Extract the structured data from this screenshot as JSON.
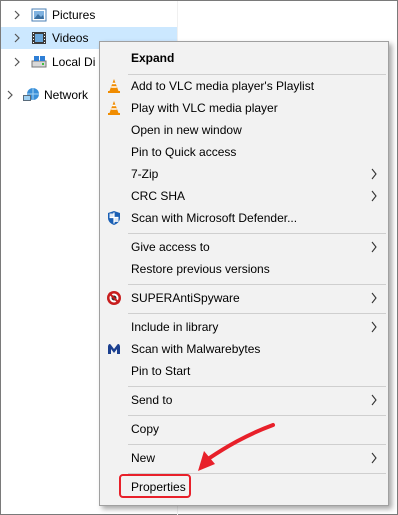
{
  "tree": {
    "items": [
      {
        "label": "Pictures"
      },
      {
        "label": "Videos"
      },
      {
        "label": "Local Di"
      },
      {
        "label": "Network"
      }
    ]
  },
  "menu": {
    "items": [
      {
        "label": "Expand",
        "icon": "none"
      },
      {
        "label": "Add to VLC media player's Playlist",
        "icon": "vlc-cone-icon"
      },
      {
        "label": "Play with VLC media player",
        "icon": "vlc-cone-icon"
      },
      {
        "label": "Open in new window",
        "icon": "none"
      },
      {
        "label": "Pin to Quick access",
        "icon": "none"
      },
      {
        "label": "7-Zip",
        "icon": "none",
        "submenu": true
      },
      {
        "label": "CRC SHA",
        "icon": "none",
        "submenu": true
      },
      {
        "label": "Scan with Microsoft Defender...",
        "icon": "defender-shield-icon"
      },
      {
        "label": "Give access to",
        "icon": "none",
        "submenu": true
      },
      {
        "label": "Restore previous versions",
        "icon": "none"
      },
      {
        "label": "SUPERAntiSpyware",
        "icon": "superantispyware-icon",
        "submenu": true
      },
      {
        "label": "Include in library",
        "icon": "none",
        "submenu": true
      },
      {
        "label": "Scan with Malwarebytes",
        "icon": "malwarebytes-icon"
      },
      {
        "label": "Pin to Start",
        "icon": "none"
      },
      {
        "label": "Send to",
        "icon": "none",
        "submenu": true
      },
      {
        "label": "Copy",
        "icon": "none"
      },
      {
        "label": "New",
        "icon": "none",
        "submenu": true
      },
      {
        "label": "Properties",
        "icon": "none"
      }
    ]
  },
  "colors": {
    "selected_row": "#cce8ff",
    "annotation": "#e8202a",
    "vlc_orange": "#f08c00"
  }
}
